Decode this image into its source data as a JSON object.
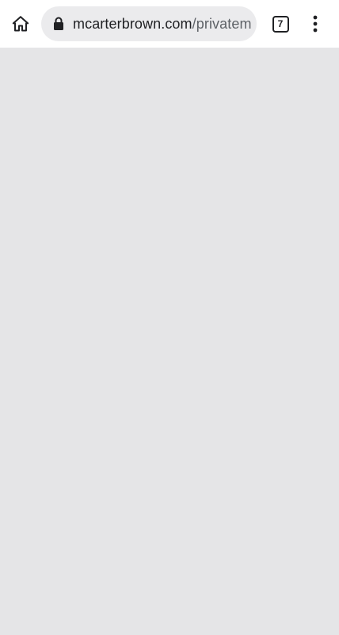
{
  "toolbar": {
    "home_icon": "home-icon",
    "url": {
      "host": "mcarterbrown.com",
      "path": "/privatem",
      "secure_icon": "lock-icon"
    },
    "tab_count": "7",
    "menu_icon": "more-vert-icon"
  },
  "content": {
    "state": "blank-loading",
    "background_color": "#e5e5e7"
  }
}
